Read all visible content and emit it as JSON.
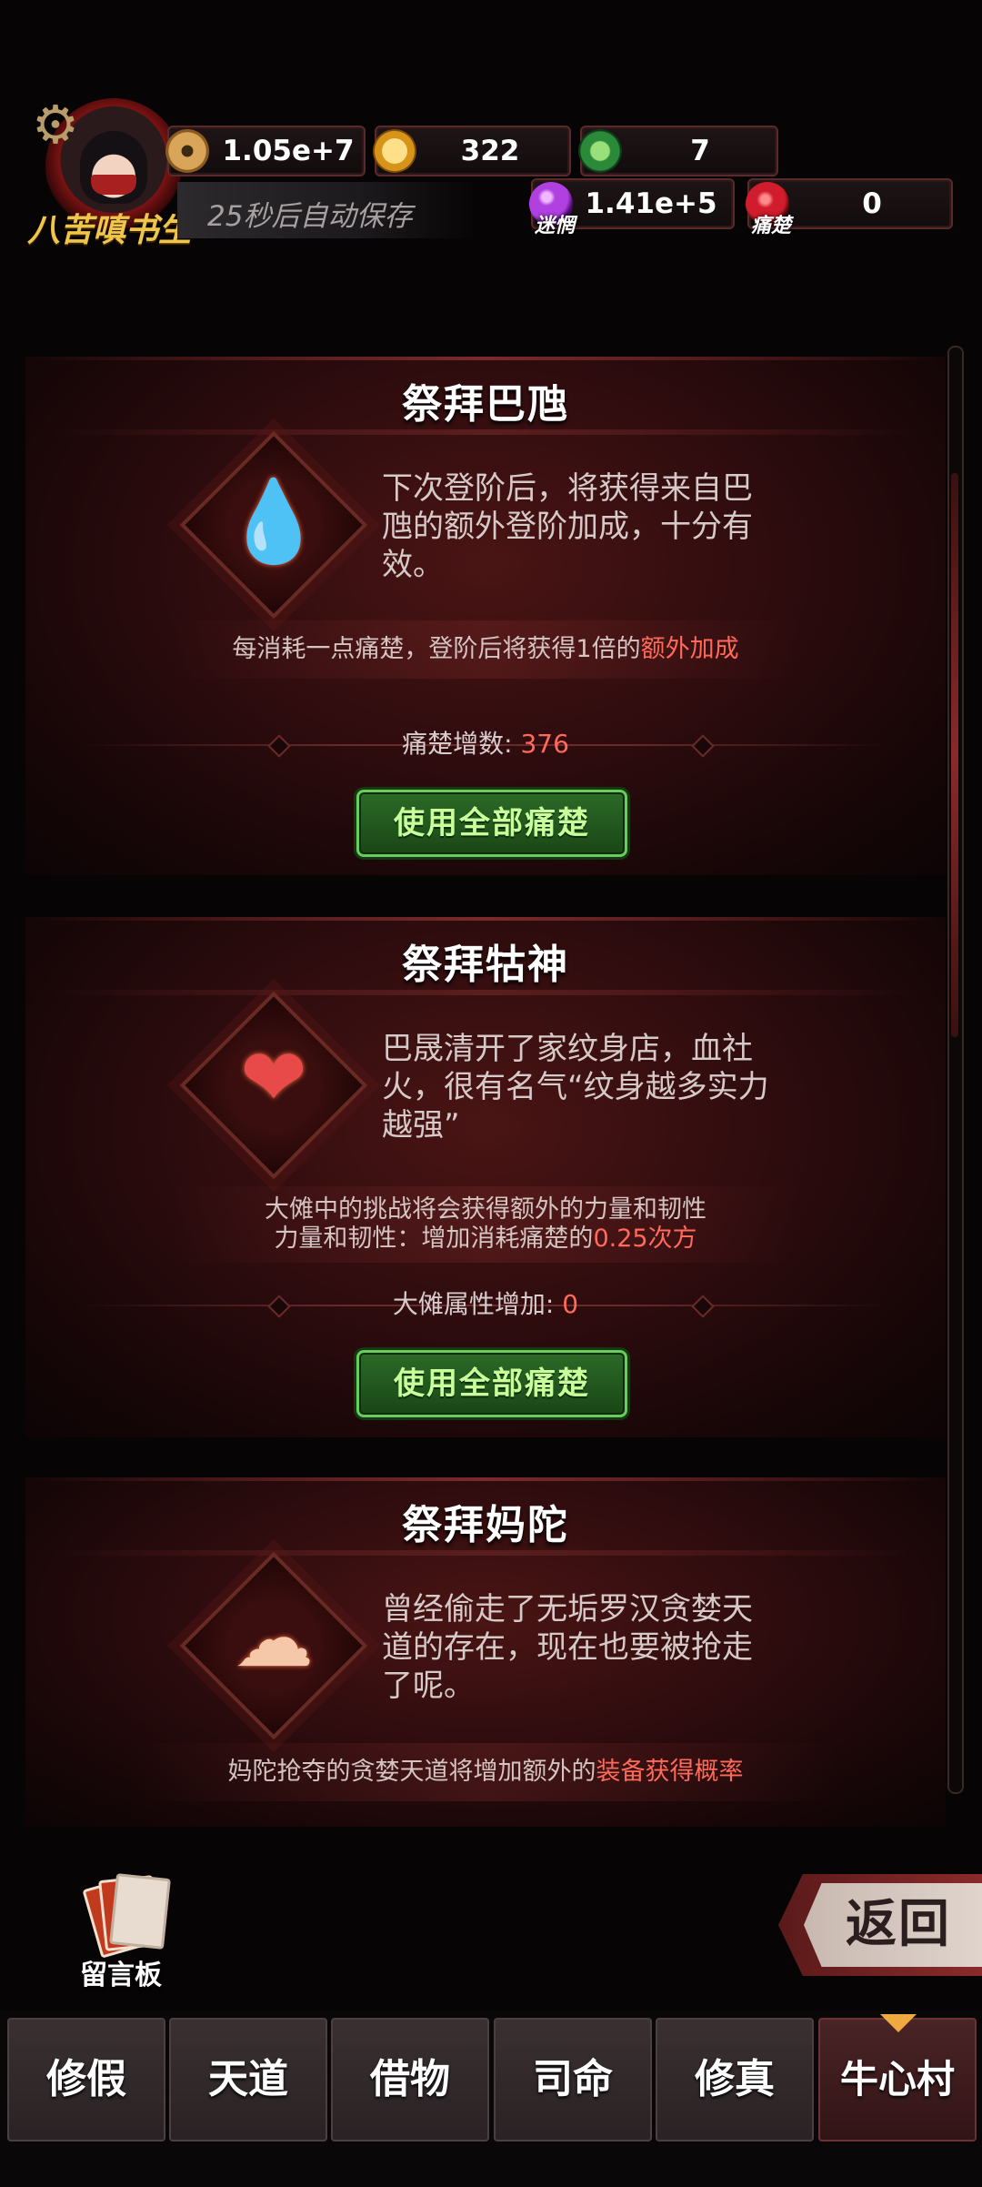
{
  "player": {
    "name": "八苦嗔书生",
    "autosave": "25秒后自动保存"
  },
  "resources": {
    "coins": "1.05e+7",
    "gold": "322",
    "jade": "7",
    "confusion": {
      "label": "迷惘",
      "value": "1.41e+5"
    },
    "pain": {
      "label": "痛楚",
      "value": "0"
    }
  },
  "cards": [
    {
      "title": "祭拜巴虺",
      "description": "下次登阶后，将获得来自巴虺的额外登阶加成，十分有效。",
      "info": [
        {
          "text": "每消耗一点痛楚，登阶后将获得1倍的",
          "highlight": "额外加成"
        }
      ],
      "stat_label": "痛楚增数: ",
      "stat_value": "376",
      "button": "使用全部痛楚",
      "icon": "blood-drop-icon"
    },
    {
      "title": "祭拜牯神",
      "description": "巴晟清开了家纹身店，血社火，很有名气“纹身越多实力越强”",
      "info": [
        {
          "text": "大傩中的挑战将会获得额外的力量和韧性",
          "highlight": ""
        },
        {
          "text": "力量和韧性：增加消耗痛楚的",
          "highlight": "0.25次方"
        }
      ],
      "stat_label": "大傩属性增加: ",
      "stat_value": "0",
      "button": "使用全部痛楚",
      "icon": "heart-icon"
    },
    {
      "title": "祭拜妈陀",
      "description": "曾经偷走了无垢罗汉贪婪天道的存在，现在也要被抢走了呢。",
      "info": [
        {
          "text": "妈陀抢夺的贪婪天道将增加额外的",
          "highlight": "装备获得概率"
        }
      ],
      "icon": "gold-ingot-icon"
    }
  ],
  "footer": {
    "board_label": "留言板",
    "back_label": "返回"
  },
  "tabs": [
    "修假",
    "天道",
    "借物",
    "司命",
    "修真",
    "牛心村"
  ],
  "active_tab": "牛心村",
  "colors": {
    "highlight": "#ff6a5a",
    "button_green": "#2c6a28",
    "name_gold": "#f0c64a"
  }
}
